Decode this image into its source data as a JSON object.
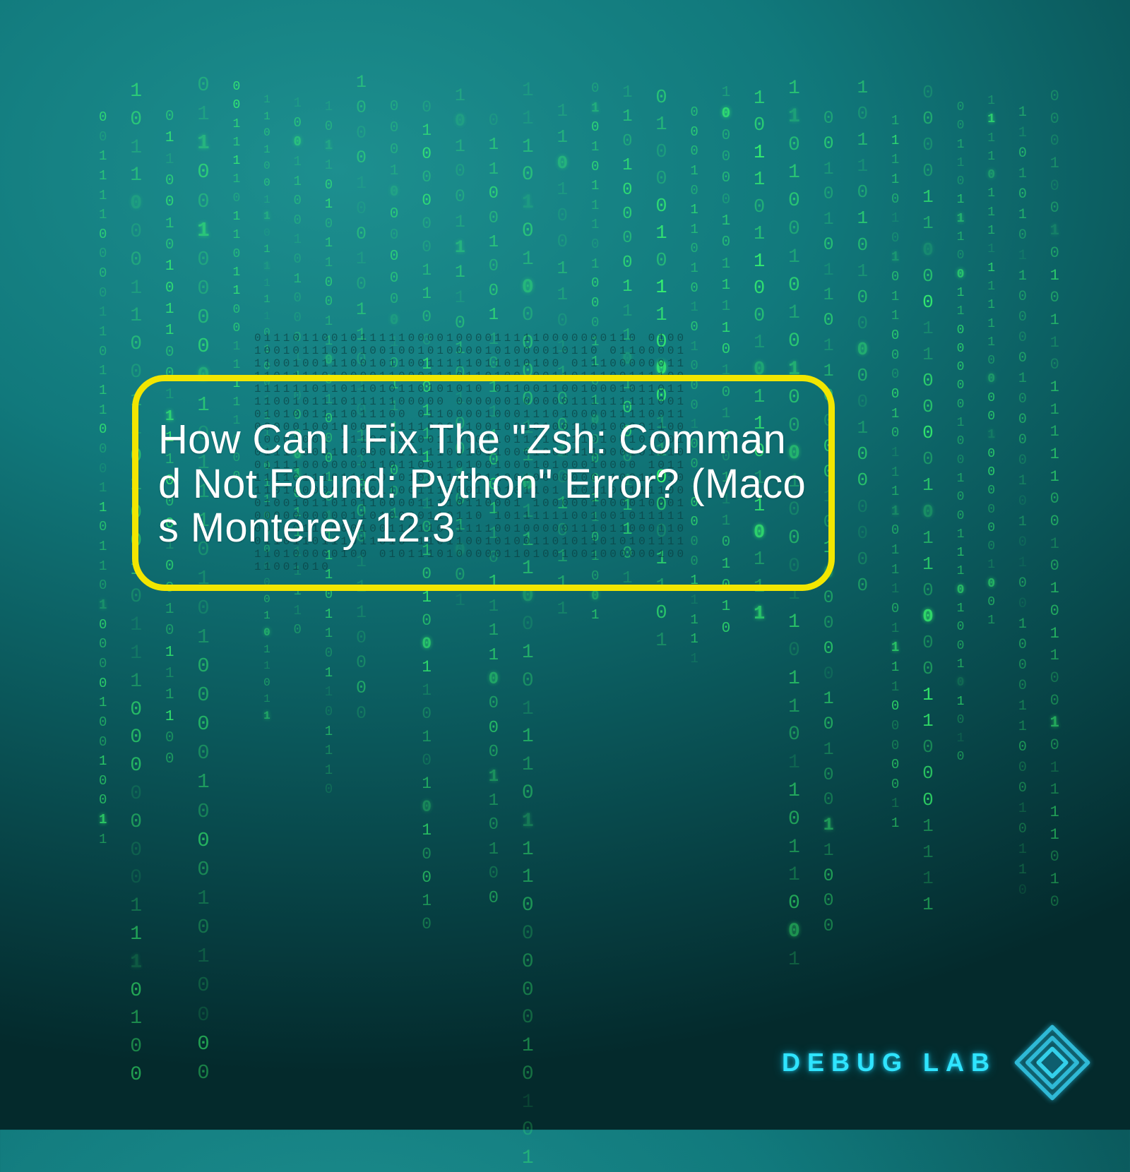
{
  "headline": "How Can I Fix The \"Zsh: Command Not Found: Python\" Error? (Macos Monterey 12.3",
  "brand": "DEBUG LAB",
  "colors": {
    "accent_border": "#f2e600",
    "brand_glow": "#2fe4ff",
    "matrix_green": "#3bff6e"
  },
  "glyphs": [
    "0",
    "1"
  ],
  "matrix": {
    "columns": 30,
    "min_len": 20,
    "max_len": 40,
    "font_min": 16,
    "font_max": 30,
    "seed": 7
  },
  "dark_block": {
    "rows": 20,
    "cols": 40,
    "seed": 3
  }
}
